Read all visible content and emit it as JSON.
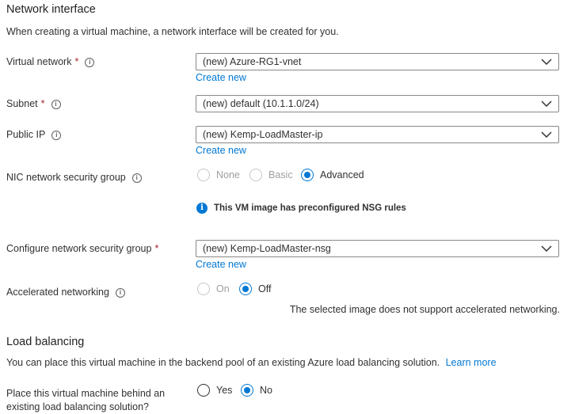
{
  "network_interface": {
    "heading": "Network interface",
    "description": "When creating a virtual machine, a network interface will be created for you."
  },
  "fields": {
    "vnet": {
      "label": "Virtual network",
      "required_mark": "*",
      "value": "(new) Azure-RG1-vnet",
      "create_new": "Create new"
    },
    "subnet": {
      "label": "Subnet",
      "required_mark": "*",
      "value": "(new) default (10.1.1.0/24)"
    },
    "public_ip": {
      "label": "Public IP",
      "value": "(new) Kemp-LoadMaster-ip",
      "create_new": "Create new"
    },
    "nic_nsg": {
      "label": "NIC network security group",
      "options": [
        "None",
        "Basic",
        "Advanced"
      ],
      "selected": "Advanced",
      "note": "This VM image has preconfigured NSG rules"
    },
    "configure_nsg": {
      "label": "Configure network security group",
      "required_mark": "*",
      "value": "(new) Kemp-LoadMaster-nsg",
      "create_new": "Create new"
    },
    "accel": {
      "label": "Accelerated networking",
      "options": [
        "On",
        "Off"
      ],
      "selected": "Off",
      "note": "The selected image does not support accelerated networking."
    }
  },
  "load_balancing": {
    "heading": "Load balancing",
    "description": "You can place this virtual machine in the backend pool of an existing Azure load balancing solution.",
    "learn_more": "Learn more",
    "question_line1": "Place this virtual machine behind an",
    "question_line2": "existing load balancing solution?",
    "options": [
      "Yes",
      "No"
    ],
    "selected": "No"
  },
  "colors": {
    "accent": "#0078d4",
    "required": "#a4262c",
    "text": "#323130"
  },
  "icons": {
    "info": "info-circle-icon",
    "dropdown": "chevron-down-icon",
    "note": "info-filled-icon"
  }
}
